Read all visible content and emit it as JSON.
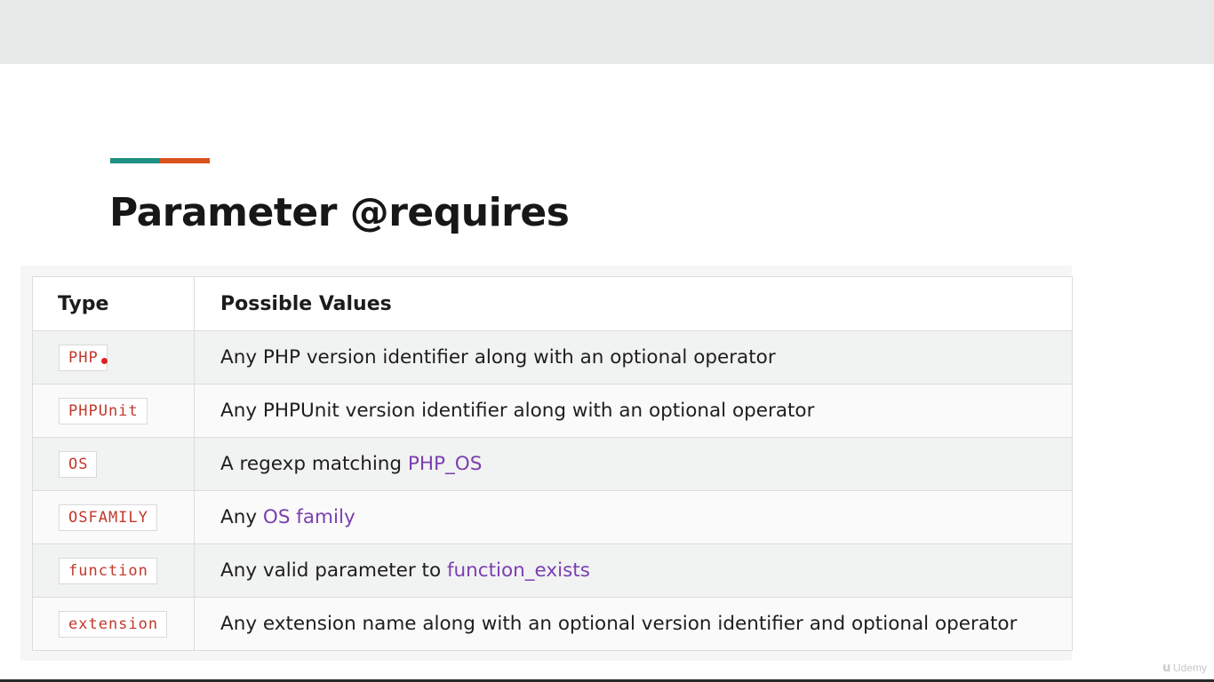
{
  "slide": {
    "title": "Parameter @requires",
    "accent_colors": [
      "#1f9182",
      "#d9531c"
    ]
  },
  "table": {
    "headers": {
      "type": "Type",
      "values": "Possible Values"
    },
    "rows": [
      {
        "type": "PHP",
        "text_before": "Any PHP version identifier along with an optional operator",
        "link": "",
        "text_after": ""
      },
      {
        "type": "PHPUnit",
        "text_before": "Any PHPUnit version identifier along with an optional operator",
        "link": "",
        "text_after": ""
      },
      {
        "type": "OS",
        "text_before": "A regexp matching ",
        "link": "PHP_OS",
        "text_after": ""
      },
      {
        "type": "OSFAMILY",
        "text_before": "Any ",
        "link": "OS family",
        "text_after": ""
      },
      {
        "type": "function",
        "text_before": "Any valid parameter to ",
        "link": "function_exists",
        "text_after": ""
      },
      {
        "type": "extension",
        "text_before": "Any extension name along with an optional version identifier and optional operator",
        "link": "",
        "text_after": ""
      }
    ],
    "colors": {
      "code_text": "#c0392b",
      "link": "#7b3fb0"
    }
  },
  "watermark": {
    "label": "Udemy",
    "icon": "udemy-logo"
  }
}
